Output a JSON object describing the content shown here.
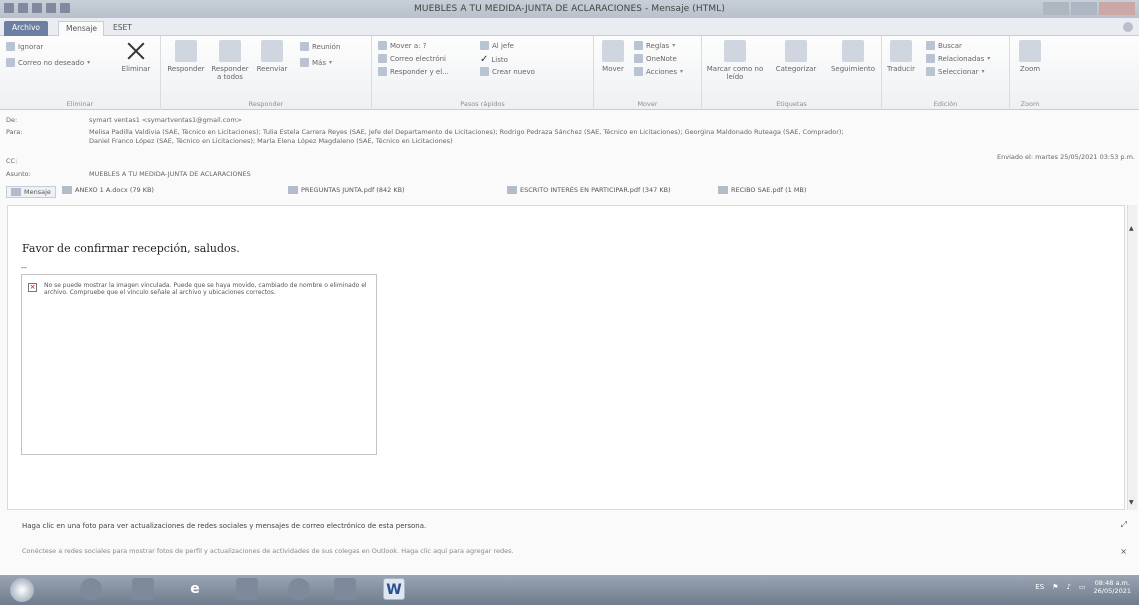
{
  "window": {
    "title": "MUEBLES A TU MEDIDA-JUNTA DE ACLARACIONES - Mensaje (HTML)"
  },
  "tabs": {
    "file": "Archivo",
    "message": "Mensaje",
    "eset": "ESET"
  },
  "ribbon": {
    "eliminar": {
      "ignore": "Ignorar",
      "junk": "Correo no deseado",
      "delete": "Eliminar",
      "label": "Eliminar"
    },
    "responder": {
      "reply": "Responder",
      "reply_all": "Responder a todos",
      "forward": "Reenviar",
      "meeting": "Reunión",
      "more": "Más",
      "label": "Responder"
    },
    "pasos": {
      "move_to": "Mover a: ?",
      "email": "Correo electróni",
      "reply_del": "Responder y el...",
      "manager": "Al jefe",
      "done": "Listo",
      "create": "Crear nuevo",
      "label": "Pasos rápidos"
    },
    "mover": {
      "move": "Mover",
      "rules": "Reglas",
      "onenote": "OneNote",
      "actions": "Acciones",
      "label": "Mover"
    },
    "etiquetas": {
      "unread": "Marcar como no leído",
      "categorize": "Categorizar",
      "followup": "Seguimiento",
      "label": "Etiquetas"
    },
    "edicion": {
      "translate": "Traducir",
      "find": "Buscar",
      "related": "Relacionadas",
      "select": "Seleccionar",
      "label": "Edición"
    },
    "zoom": {
      "zoom": "Zoom",
      "label": "Zoom"
    }
  },
  "header": {
    "from_label": "De:",
    "from": "symart ventas1 <symartventas1@gmail.com>",
    "to_label": "Para:",
    "to_line1": "Melisa Padilla Valdivia (SAE, Técnico en Licitaciones); Tulia Estela Carrera Reyes (SAE, Jefe del Departamento de Licitaciones); Rodrigo Pedraza Sánchez (SAE, Técnico en Licitaciones); Georgina Maldonado Ruteaga (SAE, Comprador);",
    "to_line2": "Daniel Franco López (SAE, Técnico en Licitaciones); María Elena López Magdaleno (SAE, Técnico en Licitaciones)",
    "cc_label": "CC:",
    "subject_label": "Asunto:",
    "subject": "MUEBLES A TU MEDIDA-JUNTA DE ACLARACIONES",
    "sent": "Enviado el:  martes 25/05/2021 03:53 p.m."
  },
  "attachments": {
    "message_tab": "Mensaje",
    "items": [
      "ANEXO 1 A.docx (79 KB)",
      "PREGUNTAS JUNTA.pdf (842 KB)",
      "ESCRITO INTERÉS EN PARTICIPAR.pdf (347 KB)",
      "RECIBO SAE.pdf (1 MB)"
    ]
  },
  "body": {
    "greeting": "Favor de confirmar recepción, saludos.",
    "signature_sep": "--",
    "broken_image_text": "No se puede mostrar la imagen vinculada. Puede que se haya movido, cambiado de nombre o eliminado el archivo. Compruebe que el vínculo señale al archivo y ubicaciones correctos."
  },
  "people_pane": {
    "line1": "Haga clic en una foto para ver actualizaciones de redes sociales y mensajes de correo electrónico de esta persona.",
    "line2": "Conéctese a redes sociales para mostrar fotos de perfil y actualizaciones de actividades de sus colegas en Outlook. Haga clic aquí para agregar redes."
  },
  "taskbar": {
    "word": "W",
    "ie": "e",
    "lang": "ES",
    "time": "08:48 a.m.",
    "date": "26/05/2021"
  }
}
